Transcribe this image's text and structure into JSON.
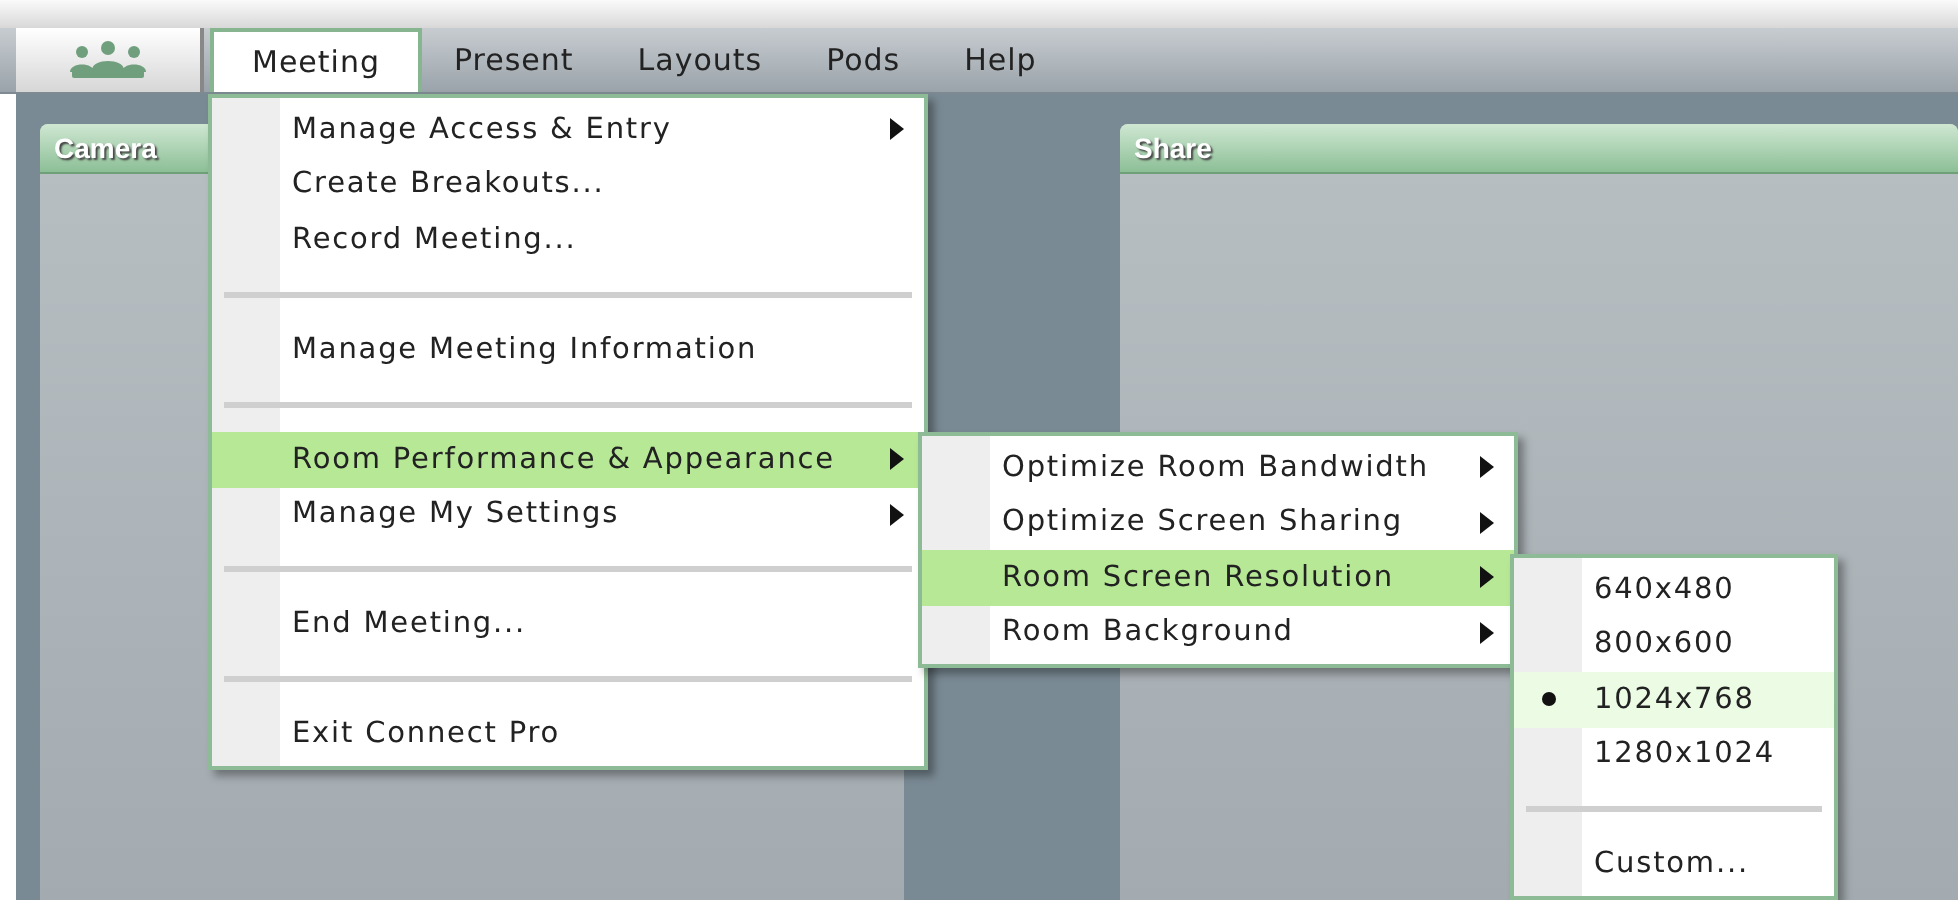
{
  "menubar": {
    "items": [
      {
        "label": "Meeting",
        "selected": true
      },
      {
        "label": "Present",
        "selected": false
      },
      {
        "label": "Layouts",
        "selected": false
      },
      {
        "label": "Pods",
        "selected": false
      },
      {
        "label": "Help",
        "selected": false
      }
    ]
  },
  "pods": [
    {
      "title": "Camera"
    },
    {
      "title": "Share"
    }
  ],
  "menus": [
    {
      "items": [
        {
          "kind": "item",
          "label": "Manage Access & Entry",
          "submenu": true,
          "selected": false
        },
        {
          "kind": "item",
          "label": "Create Breakouts...",
          "submenu": false,
          "selected": false
        },
        {
          "kind": "item",
          "label": "Record Meeting...",
          "submenu": false,
          "selected": false
        },
        {
          "kind": "separator"
        },
        {
          "kind": "item",
          "label": "Manage Meeting Information",
          "submenu": false,
          "selected": false
        },
        {
          "kind": "separator"
        },
        {
          "kind": "item",
          "label": "Room Performance & Appearance",
          "submenu": true,
          "selected": true
        },
        {
          "kind": "item",
          "label": "Manage My Settings",
          "submenu": true,
          "selected": false
        },
        {
          "kind": "separator"
        },
        {
          "kind": "item",
          "label": "End Meeting...",
          "submenu": false,
          "selected": false
        },
        {
          "kind": "separator"
        },
        {
          "kind": "item",
          "label": "Exit Connect Pro",
          "submenu": false,
          "selected": false
        }
      ]
    },
    {
      "items": [
        {
          "kind": "item",
          "label": "Optimize Room Bandwidth",
          "submenu": true,
          "selected": false
        },
        {
          "kind": "item",
          "label": "Optimize Screen Sharing",
          "submenu": true,
          "selected": false
        },
        {
          "kind": "item",
          "label": "Room Screen Resolution",
          "submenu": true,
          "selected": true
        },
        {
          "kind": "item",
          "label": "Room Background",
          "submenu": true,
          "selected": false
        }
      ]
    },
    {
      "items": [
        {
          "kind": "item",
          "label": "640x480",
          "checked": false,
          "selected": false
        },
        {
          "kind": "item",
          "label": "800x600",
          "checked": false,
          "selected": false
        },
        {
          "kind": "item",
          "label": "1024x768",
          "checked": true,
          "selected": false
        },
        {
          "kind": "item",
          "label": "1280x1024",
          "checked": false,
          "selected": false
        },
        {
          "kind": "separator"
        },
        {
          "kind": "item",
          "label": "Custom...",
          "checked": false,
          "selected": false
        }
      ]
    }
  ]
}
